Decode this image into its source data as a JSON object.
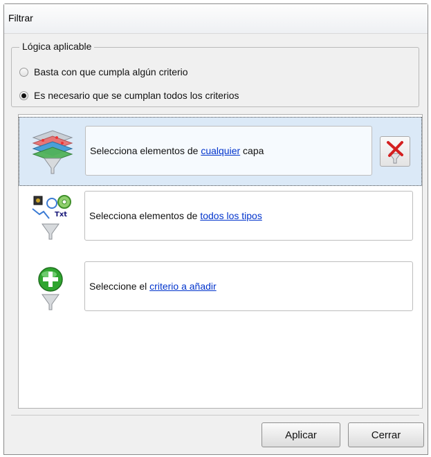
{
  "window": {
    "title": "Filtrar"
  },
  "logic": {
    "legend": "Lógica aplicable",
    "options": [
      {
        "label": "Basta con que cumpla algún criterio",
        "checked": false
      },
      {
        "label": "Es necesario que se cumplan todos los criterios",
        "checked": true
      }
    ]
  },
  "criteria": [
    {
      "icon": "layers-filter-icon",
      "prefix": "Selecciona elementos de ",
      "link": "cualquier",
      "suffix": " capa",
      "selected": true
    },
    {
      "icon": "element-types-filter-icon",
      "prefix": "Selecciona elementos de ",
      "link": "todos los tipos",
      "suffix": "",
      "selected": false
    },
    {
      "icon": "add-criterion-icon",
      "prefix": "Seleccione el ",
      "link": "criterio a añadir",
      "suffix": "",
      "selected": false
    }
  ],
  "buttons": {
    "apply": "Aplicar",
    "close": "Cerrar"
  },
  "colors": {
    "selection": "#dbe9f7",
    "link": "#0033cc",
    "delete": "#d42020",
    "add": "#2fa52f"
  }
}
